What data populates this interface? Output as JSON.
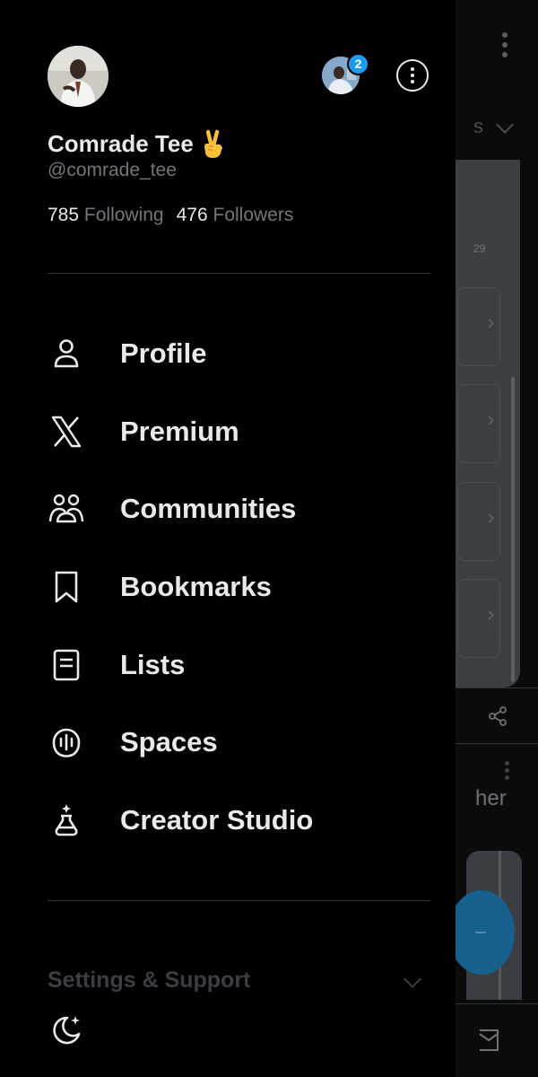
{
  "profile": {
    "display_name": "Comrade Tee",
    "handle": "@comrade_tee",
    "following_count": "785",
    "following_label": "Following",
    "followers_count": "476",
    "followers_label": "Followers"
  },
  "account_switcher": {
    "badge_count": "2"
  },
  "menu": {
    "items": [
      {
        "label": "Profile",
        "icon": "person-icon"
      },
      {
        "label": "Premium",
        "icon": "x-logo-icon"
      },
      {
        "label": "Communities",
        "icon": "communities-icon"
      },
      {
        "label": "Bookmarks",
        "icon": "bookmark-icon"
      },
      {
        "label": "Lists",
        "icon": "list-icon"
      },
      {
        "label": "Spaces",
        "icon": "spaces-icon"
      },
      {
        "label": "Creator Studio",
        "icon": "flask-icon"
      }
    ]
  },
  "settings_section": {
    "label": "Settings & Support"
  },
  "background": {
    "tab_fragment": "s",
    "card_number": "29",
    "text_fragment": "her"
  },
  "colors": {
    "background": "#000000",
    "primary_text": "#e7e9ea",
    "secondary_text": "#71767b",
    "accent": "#1d9bf0",
    "divider": "#2f3336"
  }
}
